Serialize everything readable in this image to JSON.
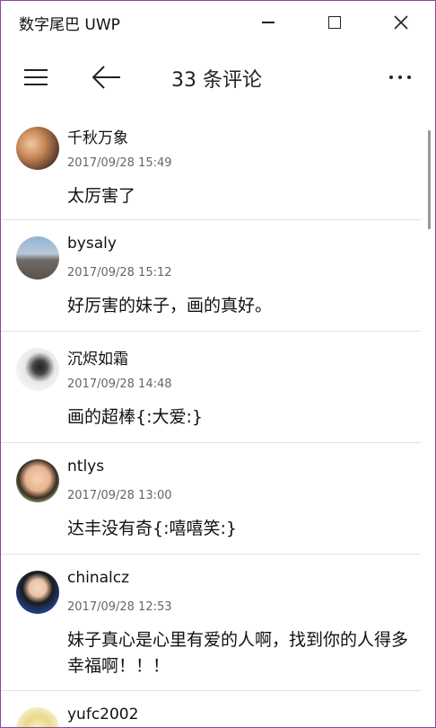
{
  "window": {
    "title": "数字尾巴 UWP"
  },
  "toolbar": {
    "page_title": "33 条评论"
  },
  "comments": [
    {
      "user": "千秋万象",
      "time": "2017/09/28 15:49",
      "text": "太厉害了"
    },
    {
      "user": "bysaly",
      "time": "2017/09/28 15:12",
      "text": "好厉害的妹子，画的真好。"
    },
    {
      "user": "沉烬如霜",
      "time": "2017/09/28 14:48",
      "text": "画的超棒{:大爱:}"
    },
    {
      "user": "ntlys",
      "time": "2017/09/28 13:00",
      "text": "达丰没有奇{:嘻嘻笑:}"
    },
    {
      "user": "chinalcz",
      "time": "2017/09/28 12:53",
      "text": "妹子真心是心里有爱的人啊，找到你的人得多幸福啊！！！"
    },
    {
      "user": "yufc2002",
      "time": "",
      "text": ""
    }
  ],
  "icons": {
    "menu": "hamburger-icon",
    "back": "arrow-left-icon",
    "more": "more-horizontal-icon",
    "minimize": "minimize-icon",
    "maximize": "maximize-icon",
    "close": "close-icon"
  },
  "colors": {
    "window_border": "#8a4a9a",
    "divider": "#e3e3e3",
    "timestamp": "#666666"
  }
}
